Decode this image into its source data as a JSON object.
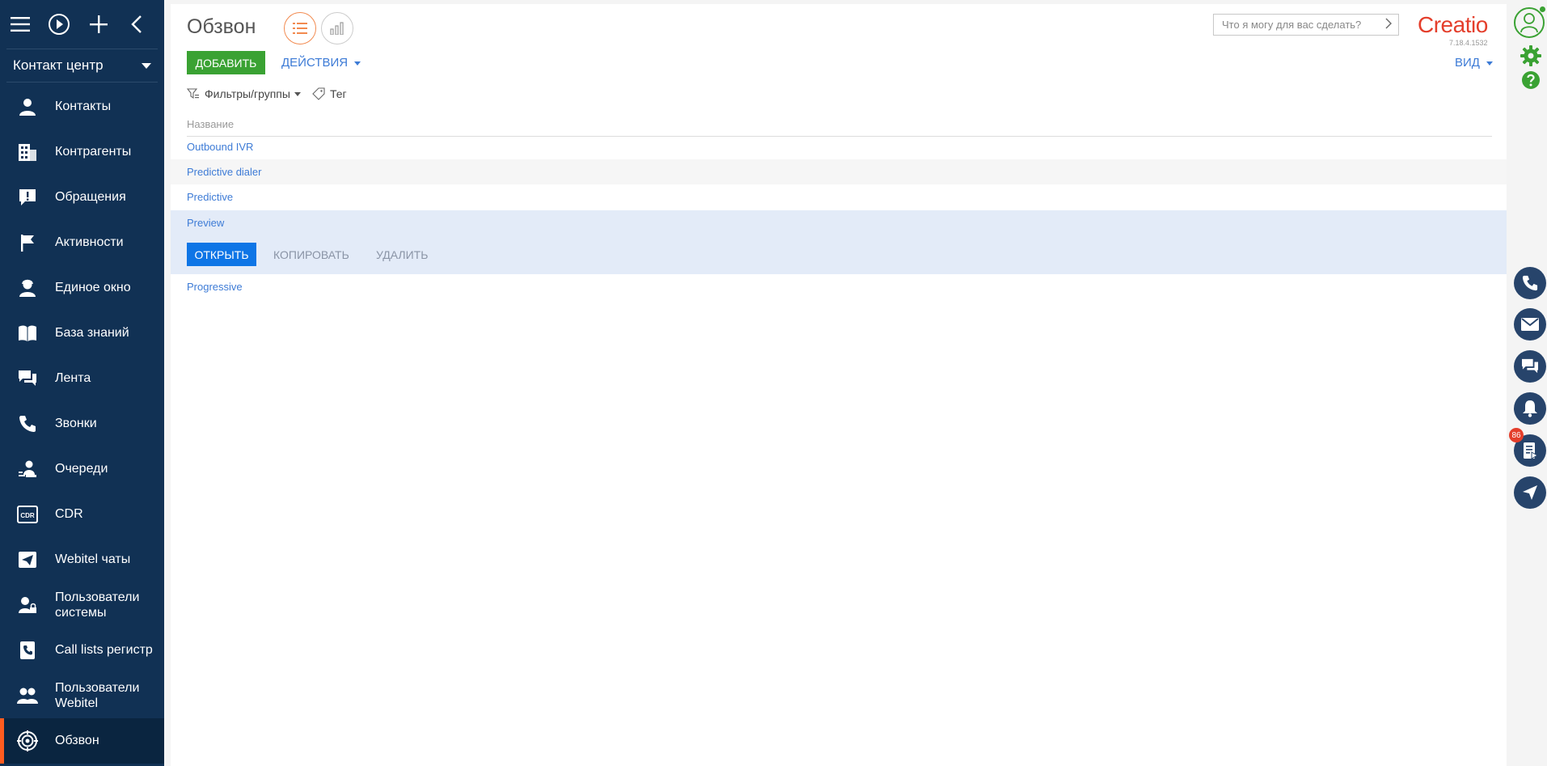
{
  "sidebar": {
    "workplace": "Контакт центр",
    "items": [
      {
        "label": "Контакты",
        "icon": "person-icon"
      },
      {
        "label": "Контрагенты",
        "icon": "building-icon"
      },
      {
        "label": "Обращения",
        "icon": "exclamation-icon"
      },
      {
        "label": "Активности",
        "icon": "flag-icon"
      },
      {
        "label": "Единое окно",
        "icon": "agent-icon"
      },
      {
        "label": "База знаний",
        "icon": "book-icon"
      },
      {
        "label": "Лента",
        "icon": "chat-icon"
      },
      {
        "label": "Звонки",
        "icon": "phone-icon"
      },
      {
        "label": "Очереди",
        "icon": "queue-icon"
      },
      {
        "label": "CDR",
        "icon": "cdr-icon"
      },
      {
        "label": "Webitel чаты",
        "icon": "send-icon"
      },
      {
        "label": "Пользователи системы",
        "icon": "user-lock-icon"
      },
      {
        "label": "Call lists регистр",
        "icon": "call-list-icon"
      },
      {
        "label": "Пользователи Webitel",
        "icon": "users-icon"
      },
      {
        "label": "Обзвон",
        "icon": "dialer-icon"
      }
    ]
  },
  "header": {
    "title": "Обзвон",
    "search_placeholder": "Что я могу для вас сделать?",
    "logo": "Creatio",
    "version": "7.18.4.1532"
  },
  "toolbar": {
    "add_label": "ДОБАВИТЬ",
    "actions_label": "ДЕЙСТВИЯ",
    "view_label": "ВИД",
    "filters_label": "Фильтры/группы",
    "tag_label": "Тег"
  },
  "grid": {
    "column_header": "Название",
    "rows": [
      "Outbound IVR",
      "Predictive dialer",
      "Predictive",
      "Preview",
      "Progressive"
    ],
    "row_buttons": {
      "open": "ОТКРЫТЬ",
      "copy": "КОПИРОВАТЬ",
      "delete": "УДАЛИТЬ"
    }
  },
  "right_panel": {
    "notification_count": "86"
  },
  "colors": {
    "sidebar": "#113154",
    "accent": "#ff5c1f",
    "add_button": "#3aa233",
    "open_button": "#0e75e6",
    "link": "#3d7bd6"
  }
}
